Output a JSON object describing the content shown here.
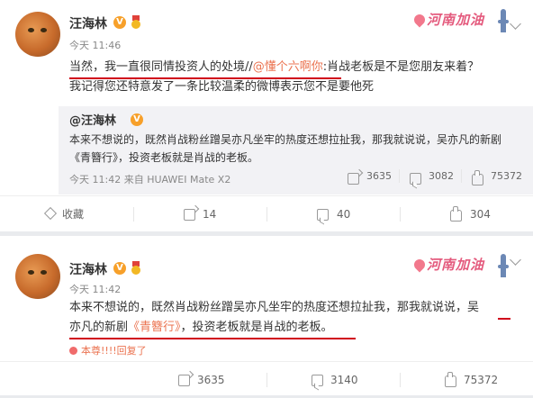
{
  "post1": {
    "username": "汪海林",
    "verified_badge": "V",
    "time": "今天 11:46",
    "tag_text": "河南加油",
    "line1_part1": "当然，我一直很同情投资人的处境//",
    "line1_mention": "@懂个六啊你",
    "line1_part2": ":肖战老板是不是您朋友来着？",
    "line2": "我记得您还特意发了一条比较温柔的微博表示您不是要他死",
    "repost": {
      "user": "@汪海林",
      "badge": "V",
      "line1": "本来不想说的，既然肖战粉丝蹭吴亦凡坐牢的热度还想拉扯我，那我就说说，吴亦凡的新剧",
      "line2": "《青簪行》，投资老板就是肖战的老板。",
      "meta": "今天 11:42 来自 HUAWEI Mate X2",
      "forwards": "3635",
      "comments": "3082",
      "likes": "75372"
    },
    "actions": {
      "favorite": "收藏",
      "forward": "14",
      "comment": "40",
      "like": "304"
    }
  },
  "post2": {
    "username": "汪海林",
    "verified_badge": "V",
    "time": "今天 11:42",
    "tag_text": "河南加油",
    "line1": "本来不想说的，既然肖战粉丝蹭吴亦凡坐牢的热度还想拉扯我，那我就说说，吴",
    "line2_part1": "亦凡的新剧",
    "line2_link": "《青簪行》",
    "line2_part2": "，投资老板就是肖战的老板。",
    "reply_note": "本尊!!!!回复了",
    "actions": {
      "forward": "3635",
      "comment": "3140",
      "like": "75372"
    }
  }
}
